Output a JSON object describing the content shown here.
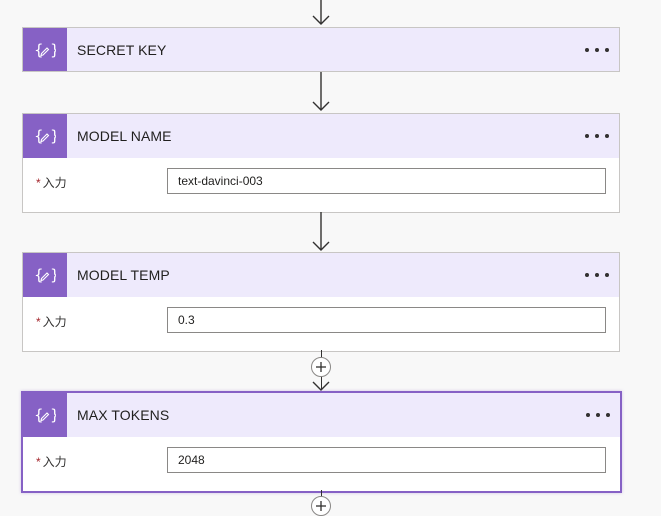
{
  "steps": [
    {
      "title": "SECRET KEY"
    },
    {
      "title": "MODEL NAME",
      "label": "入力",
      "value": "text-davinci-003"
    },
    {
      "title": "MODEL TEMP",
      "label": "入力",
      "value": "0.3"
    },
    {
      "title": "MAX TOKENS",
      "label": "入力",
      "value": "2048"
    }
  ],
  "required_marker": "*",
  "icons": {
    "step": "variable-curly-braces-icon",
    "more": "more-ellipsis-icon",
    "arrow": "arrow-down-icon",
    "insert": "plus-icon"
  },
  "colors": {
    "accent": "#8661c5",
    "header_bg": "#eeeafc",
    "required": "#a4262c"
  }
}
